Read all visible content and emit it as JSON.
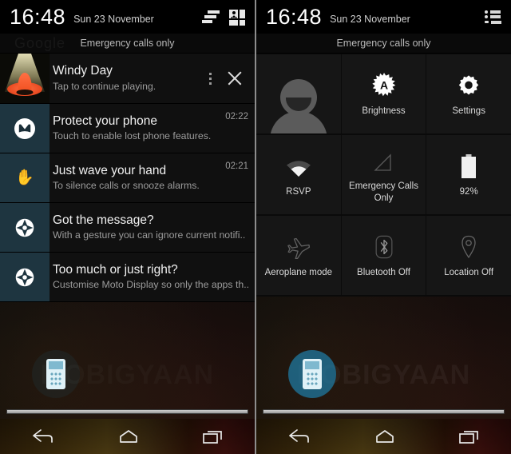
{
  "status_bar": {
    "time": "16:48",
    "date": "Sun 23 November",
    "left_icons": [
      "signal-bars-icon",
      "user-grid-icon"
    ],
    "right_icon": "notification-list-icon"
  },
  "carrier": {
    "text": "Emergency calls only",
    "ghost_widget": "Google"
  },
  "notifications": [
    {
      "icon": "vlc-cone-album-art",
      "title": "Windy Day",
      "subtitle": "Tap to continue playing.",
      "time": "",
      "has_menu": true,
      "has_close": true,
      "icon_bg": "#000000"
    },
    {
      "icon": "motorola-logo-icon",
      "title": "Protect your phone",
      "subtitle": "Touch to enable lost phone features.",
      "time": "02:22",
      "has_menu": false,
      "has_close": false,
      "icon_bg": "#1e3540"
    },
    {
      "icon": "hand-wave-icon",
      "title": "Just wave your hand",
      "subtitle": "To silence calls or snooze alarms.",
      "time": "02:21",
      "has_menu": false,
      "has_close": false,
      "icon_bg": "#1e3540"
    },
    {
      "icon": "moto-display-burst-icon",
      "title": "Got the message?",
      "subtitle": "With a gesture you can ignore current notifi..",
      "time": "",
      "has_menu": false,
      "has_close": false,
      "icon_bg": "#1e3540"
    },
    {
      "icon": "moto-display-burst-icon",
      "title": "Too much or just right?",
      "subtitle": "Customise Moto Display so only the apps th..",
      "time": "",
      "has_menu": false,
      "has_close": false,
      "icon_bg": "#1e3540"
    }
  ],
  "quick_settings": {
    "rows": [
      [
        {
          "icon": "user-avatar-icon",
          "label": "",
          "state": "on"
        },
        {
          "icon": "brightness-auto-icon",
          "label": "Brightness",
          "state": "on"
        },
        {
          "icon": "settings-gear-icon",
          "label": "Settings",
          "state": "on"
        }
      ],
      [
        {
          "icon": "wifi-icon",
          "label": "RSVP",
          "state": "on"
        },
        {
          "icon": "cell-signal-icon",
          "label": "Emergency Calls Only",
          "state": "off"
        },
        {
          "icon": "battery-icon",
          "label": "92%",
          "state": "on"
        }
      ],
      [
        {
          "icon": "aeroplane-icon",
          "label": "Aeroplane mode",
          "state": "off"
        },
        {
          "icon": "bluetooth-icon",
          "label": "Bluetooth Off",
          "state": "off"
        },
        {
          "icon": "location-pin-icon",
          "label": "Location Off",
          "state": "off"
        }
      ]
    ]
  },
  "watermark": {
    "text": "MOBIGYAAN",
    "logo": "phone-circle-logo"
  },
  "nav_bar": {
    "back": "back-icon",
    "home": "home-icon",
    "recents": "recents-icon"
  },
  "colors": {
    "accent_teal": "#1e3540",
    "shade_bg": "#0d0d0d",
    "tile_bg": "#161616",
    "text_primary": "#f2f2f2",
    "text_secondary": "#9c9c9c",
    "watermark_teal": "#1f78a0"
  }
}
